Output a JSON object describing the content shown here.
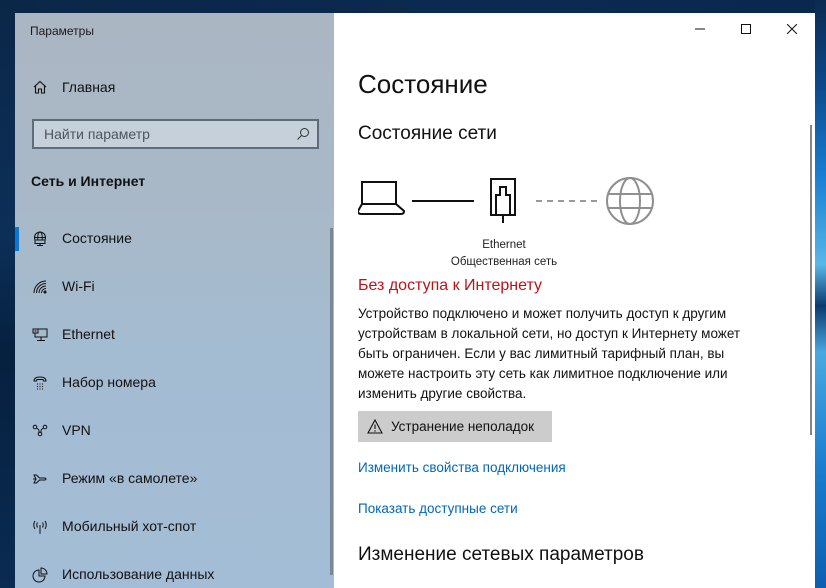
{
  "window": {
    "app_title": "Параметры",
    "controls": {
      "minimize": "minimize",
      "maximize": "maximize",
      "close": "close"
    }
  },
  "sidebar": {
    "home_label": "Главная",
    "search": {
      "placeholder": "Найти параметр",
      "value": ""
    },
    "section_title": "Сеть и Интернет",
    "items": [
      {
        "label": "Состояние",
        "icon": "network-globe-icon",
        "active": true
      },
      {
        "label": "Wi-Fi",
        "icon": "wifi-icon",
        "active": false
      },
      {
        "label": "Ethernet",
        "icon": "ethernet-icon",
        "active": false
      },
      {
        "label": "Набор номера",
        "icon": "dialup-icon",
        "active": false
      },
      {
        "label": "VPN",
        "icon": "vpn-icon",
        "active": false
      },
      {
        "label": "Режим «в самолете»",
        "icon": "airplane-icon",
        "active": false
      },
      {
        "label": "Мобильный хот-спот",
        "icon": "hotspot-icon",
        "active": false
      },
      {
        "label": "Использование данных",
        "icon": "data-usage-icon",
        "active": false
      }
    ]
  },
  "main": {
    "page_title": "Состояние",
    "subtitle": "Состояние сети",
    "diagram": {
      "connection_name": "Ethernet",
      "network_type": "Общественная сеть"
    },
    "status_heading": "Без доступа к Интернету",
    "status_description": "Устройство подключено и может получить доступ к другим устройствам в локальной сети, но доступ к Интернету может быть ограничен. Если у вас лимитный тарифный план, вы можете настроить эту сеть как лимитное подключение или изменить другие свойства.",
    "troubleshoot_label": "Устранение неполадок",
    "links": {
      "change_properties": "Изменить свойства подключения",
      "show_networks": "Показать доступные сети"
    },
    "section_heading": "Изменение сетевых параметров"
  },
  "colors": {
    "accent": "#0a78d7",
    "error": "#b8151b",
    "link": "#0067b8"
  }
}
